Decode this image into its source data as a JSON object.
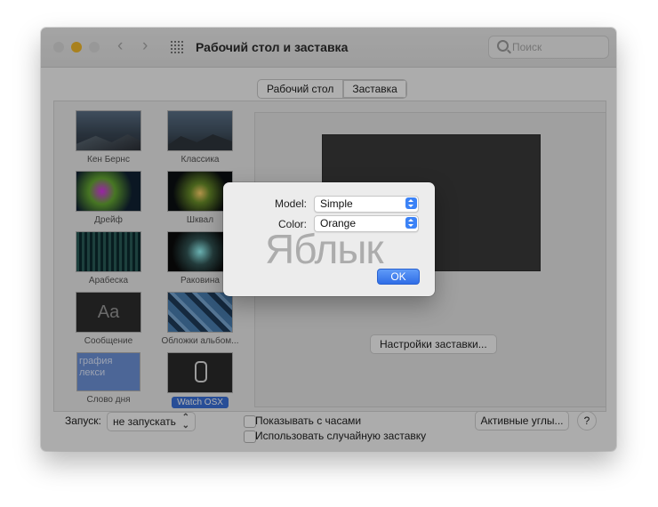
{
  "window": {
    "title": "Рабочий стол и заставка",
    "search_placeholder": "Поиск",
    "tabs": [
      {
        "label": "Рабочий стол",
        "active": false
      },
      {
        "label": "Заставка",
        "active": true
      }
    ]
  },
  "savers": [
    {
      "label": "Кен Бернс",
      "selected": false
    },
    {
      "label": "Классика",
      "selected": false
    },
    {
      "label": "Дрейф",
      "selected": false
    },
    {
      "label": "Шквал",
      "selected": false
    },
    {
      "label": "Арабеска",
      "selected": false
    },
    {
      "label": "Раковина",
      "selected": false
    },
    {
      "label": "Сообщение",
      "thumb_text": "Aa",
      "selected": false
    },
    {
      "label": "Обложки альбом...",
      "selected": false
    },
    {
      "label": "Слово дня",
      "thumb_text": "графия\nлекси",
      "selected": false
    },
    {
      "label": "Watch OSX",
      "selected": true
    }
  ],
  "preview": {
    "settings_button": "Настройки заставки..."
  },
  "bottom": {
    "start_label": "Запуск:",
    "start_value": "не запускать",
    "show_clock_label": "Показывать с часами",
    "random_label": "Использовать случайную заставку",
    "hot_corners_button": "Активные углы...",
    "help_button": "?"
  },
  "dialog": {
    "model_label": "Model:",
    "model_value": "Simple",
    "color_label": "Color:",
    "color_value": "Orange",
    "ok_label": "OK"
  },
  "watermark": "Яблык",
  "colors": {
    "accent": "#2f6de6",
    "window_bg": "#f6f6f6",
    "overlay": "rgba(0,0,0,0.30)"
  }
}
